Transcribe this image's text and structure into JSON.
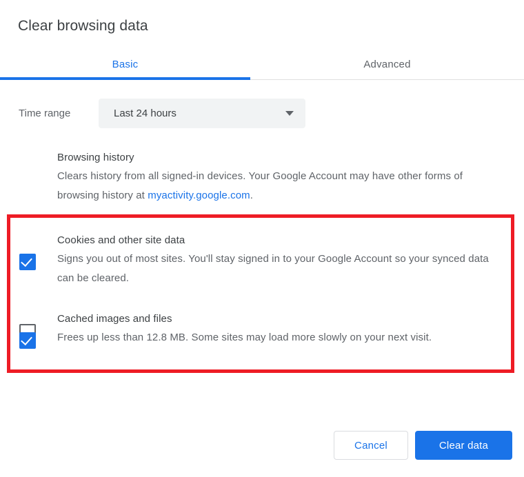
{
  "dialog": {
    "title": "Clear browsing data"
  },
  "tabs": [
    {
      "label": "Basic",
      "active": true
    },
    {
      "label": "Advanced",
      "active": false
    }
  ],
  "time_range": {
    "label": "Time range",
    "selected": "Last 24 hours",
    "arrow_icon": "chevron-down-icon"
  },
  "options": [
    {
      "id": "browsing-history",
      "title": "Browsing history",
      "desc_before_link": "Clears history from all signed-in devices. Your Google Account may have other forms of browsing history at ",
      "link_text": "myactivity.google.com",
      "desc_after_link": ".",
      "checked": false
    },
    {
      "id": "cookies-and-site-data",
      "title": "Cookies and other site data",
      "description": "Signs you out of most sites. You'll stay signed in to your Google Account so your synced data can be cleared.",
      "checked": true
    },
    {
      "id": "cached-images-and-files",
      "title": "Cached images and files",
      "description": "Frees up less than 12.8 MB. Some sites may load more slowly on your next visit.",
      "checked": true
    }
  ],
  "footer": {
    "cancel_label": "Cancel",
    "confirm_label": "Clear data"
  },
  "annotation": {
    "color": "#ee1c25",
    "shape": "rectangle-outline"
  },
  "colors": {
    "accent": "#1a73e8",
    "text_primary": "#3c4043",
    "text_secondary": "#5f6368",
    "select_background": "#f1f3f4",
    "divider": "#e0e0e0",
    "highlight": "#ee1c25"
  }
}
